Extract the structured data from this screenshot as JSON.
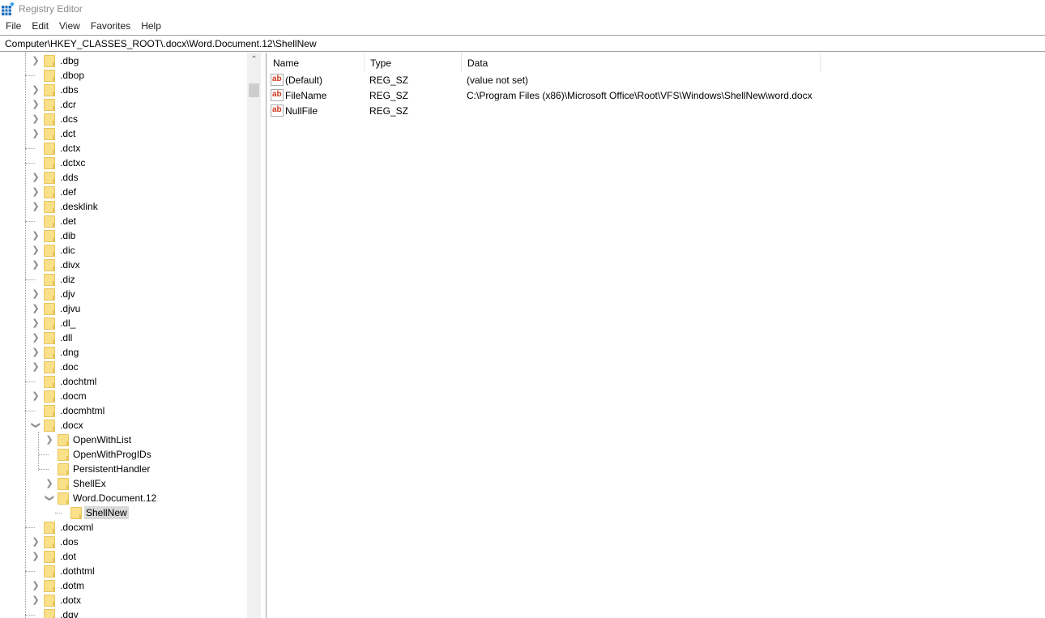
{
  "window": {
    "title": "Registry Editor",
    "icon": "registry-icon"
  },
  "menu": [
    "File",
    "Edit",
    "View",
    "Favorites",
    "Help"
  ],
  "address": "Computer\\HKEY_CLASSES_ROOT\\.docx\\Word.Document.12\\ShellNew",
  "tree": [
    {
      "label": ".dbg",
      "level": 0,
      "exp": "collapsed"
    },
    {
      "label": ".dbop",
      "level": 0,
      "exp": "none"
    },
    {
      "label": ".dbs",
      "level": 0,
      "exp": "collapsed"
    },
    {
      "label": ".dcr",
      "level": 0,
      "exp": "collapsed"
    },
    {
      "label": ".dcs",
      "level": 0,
      "exp": "collapsed"
    },
    {
      "label": ".dct",
      "level": 0,
      "exp": "collapsed"
    },
    {
      "label": ".dctx",
      "level": 0,
      "exp": "none"
    },
    {
      "label": ".dctxc",
      "level": 0,
      "exp": "none"
    },
    {
      "label": ".dds",
      "level": 0,
      "exp": "collapsed"
    },
    {
      "label": ".def",
      "level": 0,
      "exp": "collapsed"
    },
    {
      "label": ".desklink",
      "level": 0,
      "exp": "collapsed"
    },
    {
      "label": ".det",
      "level": 0,
      "exp": "none"
    },
    {
      "label": ".dib",
      "level": 0,
      "exp": "collapsed"
    },
    {
      "label": ".dic",
      "level": 0,
      "exp": "collapsed"
    },
    {
      "label": ".divx",
      "level": 0,
      "exp": "collapsed"
    },
    {
      "label": ".diz",
      "level": 0,
      "exp": "none"
    },
    {
      "label": ".djv",
      "level": 0,
      "exp": "collapsed"
    },
    {
      "label": ".djvu",
      "level": 0,
      "exp": "collapsed"
    },
    {
      "label": ".dl_",
      "level": 0,
      "exp": "collapsed"
    },
    {
      "label": ".dll",
      "level": 0,
      "exp": "collapsed"
    },
    {
      "label": ".dng",
      "level": 0,
      "exp": "collapsed"
    },
    {
      "label": ".doc",
      "level": 0,
      "exp": "collapsed"
    },
    {
      "label": ".dochtml",
      "level": 0,
      "exp": "none"
    },
    {
      "label": ".docm",
      "level": 0,
      "exp": "collapsed"
    },
    {
      "label": ".docmhtml",
      "level": 0,
      "exp": "none"
    },
    {
      "label": ".docx",
      "level": 0,
      "exp": "expanded"
    },
    {
      "label": "OpenWithList",
      "level": 1,
      "exp": "collapsed"
    },
    {
      "label": "OpenWithProgIDs",
      "level": 1,
      "exp": "none"
    },
    {
      "label": "PersistentHandler",
      "level": 1,
      "exp": "none"
    },
    {
      "label": "ShellEx",
      "level": 1,
      "exp": "collapsed"
    },
    {
      "label": "Word.Document.12",
      "level": 1,
      "exp": "expanded"
    },
    {
      "label": "ShellNew",
      "level": 2,
      "exp": "none",
      "selected": true
    },
    {
      "label": ".docxml",
      "level": 0,
      "exp": "none"
    },
    {
      "label": ".dos",
      "level": 0,
      "exp": "collapsed"
    },
    {
      "label": ".dot",
      "level": 0,
      "exp": "collapsed"
    },
    {
      "label": ".dothtml",
      "level": 0,
      "exp": "none"
    },
    {
      "label": ".dotm",
      "level": 0,
      "exp": "collapsed"
    },
    {
      "label": ".dotx",
      "level": 0,
      "exp": "collapsed"
    },
    {
      "label": ".dqy",
      "level": 0,
      "exp": "none"
    }
  ],
  "list": {
    "columns": [
      "Name",
      "Type",
      "Data"
    ],
    "rows": [
      {
        "name": "(Default)",
        "type": "REG_SZ",
        "data": "(value not set)",
        "icon": "string-value-icon"
      },
      {
        "name": "FileName",
        "type": "REG_SZ",
        "data": "C:\\Program Files (x86)\\Microsoft Office\\Root\\VFS\\Windows\\ShellNew\\word.docx",
        "icon": "string-value-icon"
      },
      {
        "name": "NullFile",
        "type": "REG_SZ",
        "data": "",
        "icon": "string-value-icon"
      }
    ]
  }
}
